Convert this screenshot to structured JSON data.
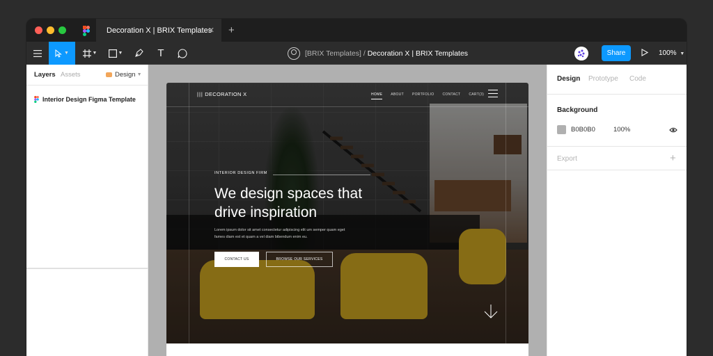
{
  "window": {
    "tab_title": "Decoration X | BRIX Templates",
    "tab_close": "✕",
    "tab_add": "+"
  },
  "toolbar": {
    "menu_icon": "hamburger-icon",
    "move_tool_icon": "cursor-icon",
    "frame_tool_icon": "hash-frame-icon",
    "shape_tool_icon": "square-icon",
    "pen_tool_icon": "pen-icon",
    "text_tool_icon": "T",
    "comment_tool_icon": "speech-bubble-icon",
    "doc_title_team": "[BRIX Templates]",
    "doc_title_sep": " / ",
    "doc_title_file": "Decoration X | BRIX Templates",
    "share_label": "Share",
    "zoom_label": "100%",
    "accent": "#0d99ff"
  },
  "left_panel": {
    "tab_layers": "Layers",
    "tab_assets": "Assets",
    "page_label": "Design",
    "layers": [
      {
        "label": "Interior Design Figma Template",
        "icon": "figma-icon"
      }
    ]
  },
  "canvas": {
    "background": "#b0b0b0",
    "site": {
      "logo": "DECORATION X",
      "nav": [
        "HOME",
        "ABOUT",
        "PORTFOLIO",
        "CONTACT",
        "CART(3)"
      ],
      "eyebrow": "INTERIOR DESIGN FIRM",
      "headline": "We design spaces that drive inspiration",
      "paragraph": "Lorem ipsum dolor sit amet consectetur adipiscing elit um semper quam eget fames diam est et quam a vel diam bibendum enim eu.",
      "btn_primary": "CONTACT US",
      "btn_secondary": "BROWSE OUR SERVICES"
    }
  },
  "right_panel": {
    "tabs": [
      "Design",
      "Prototype",
      "Code"
    ],
    "background_title": "Background",
    "bg_hex": "B0B0B0",
    "bg_opacity": "100%",
    "export_title": "Export",
    "export_add": "+"
  }
}
